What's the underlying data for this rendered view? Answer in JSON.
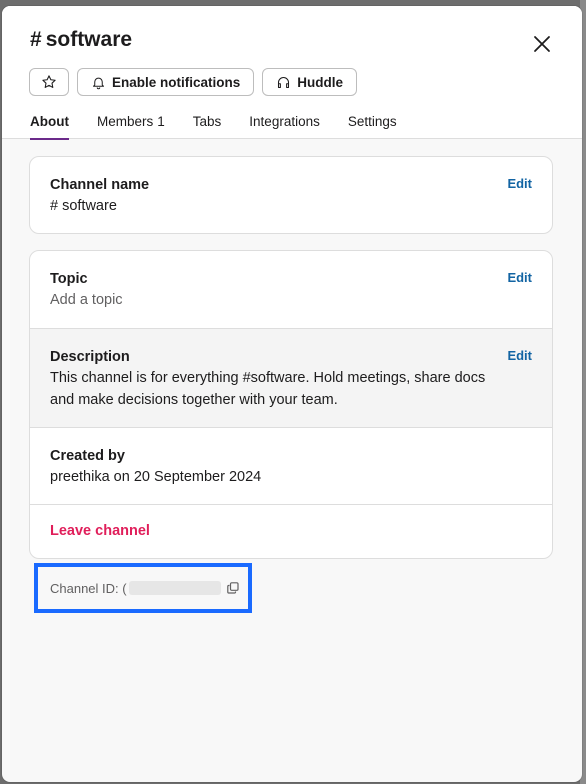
{
  "modal": {
    "title_hash": "#",
    "title": "software",
    "actions": {
      "enable_notifications": "Enable notifications",
      "huddle": "Huddle"
    },
    "tabs": [
      {
        "label": "About",
        "active": true
      },
      {
        "label": "Members",
        "count": "1"
      },
      {
        "label": "Tabs"
      },
      {
        "label": "Integrations"
      },
      {
        "label": "Settings"
      }
    ]
  },
  "channel_name": {
    "title": "Channel name",
    "value": "# software",
    "edit": "Edit"
  },
  "topic": {
    "title": "Topic",
    "placeholder": "Add a topic",
    "edit": "Edit"
  },
  "description": {
    "title": "Description",
    "value": "This channel is for everything #software. Hold meetings, share docs and make decisions together with your team.",
    "edit": "Edit"
  },
  "created_by": {
    "title": "Created by",
    "value": "preethika on 20 September 2024"
  },
  "leave": {
    "label": "Leave channel"
  },
  "channel_id": {
    "label": "Channel ID: ("
  },
  "colors": {
    "accent_tab": "#6b2a8a",
    "link": "#1264a3",
    "danger": "#e01e5a",
    "highlight_box": "#1a6aff"
  }
}
